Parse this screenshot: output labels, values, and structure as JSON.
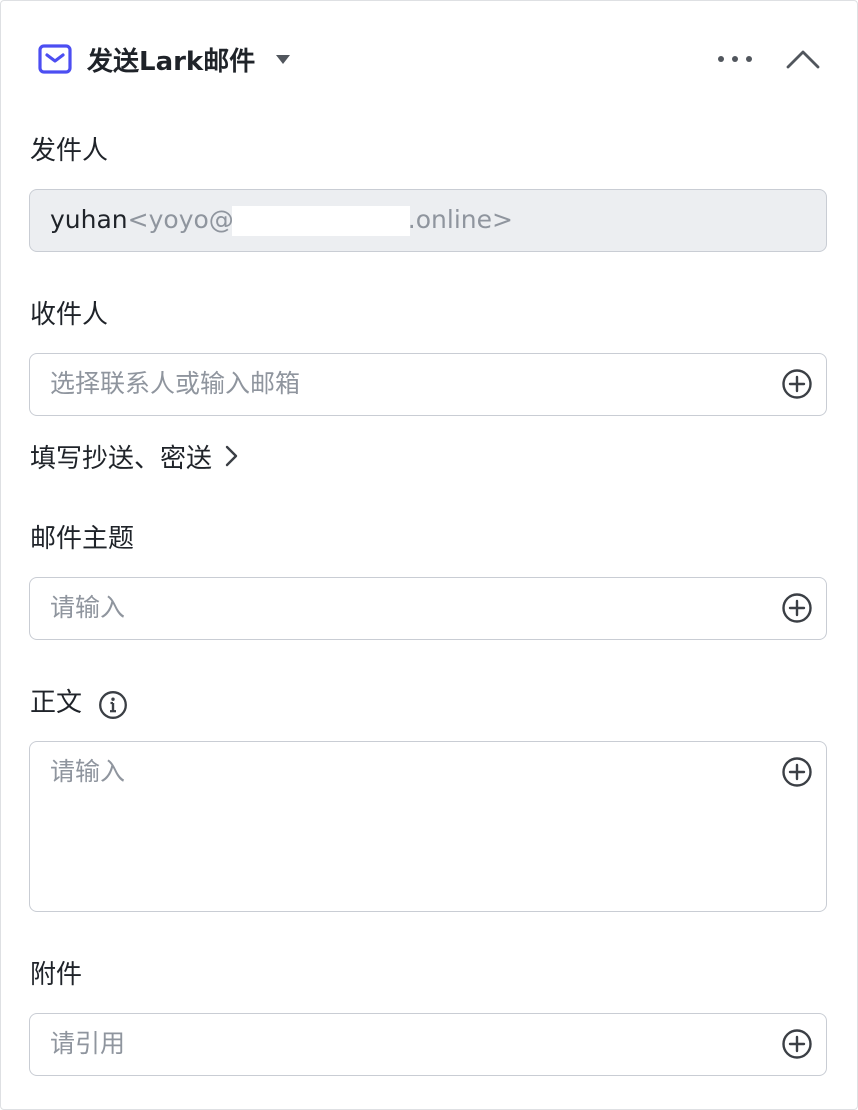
{
  "header": {
    "title": "发送Lark邮件",
    "accent_color": "#4c4ef2",
    "icons": [
      "mail-icon",
      "caret-down-icon",
      "more-icon",
      "chevron-up-icon"
    ]
  },
  "sender": {
    "label": "发件人",
    "name": "yuhan",
    "email_prefix": "<yoyo@",
    "email_suffix": ".online>"
  },
  "recipient": {
    "label": "收件人",
    "placeholder": "选择联系人或输入邮箱"
  },
  "cc_link": {
    "label": "填写抄送、密送"
  },
  "subject": {
    "label": "邮件主题",
    "placeholder": "请输入"
  },
  "body": {
    "label": "正文",
    "placeholder": "请输入"
  },
  "attachment": {
    "label": "附件",
    "placeholder": "请引用"
  }
}
